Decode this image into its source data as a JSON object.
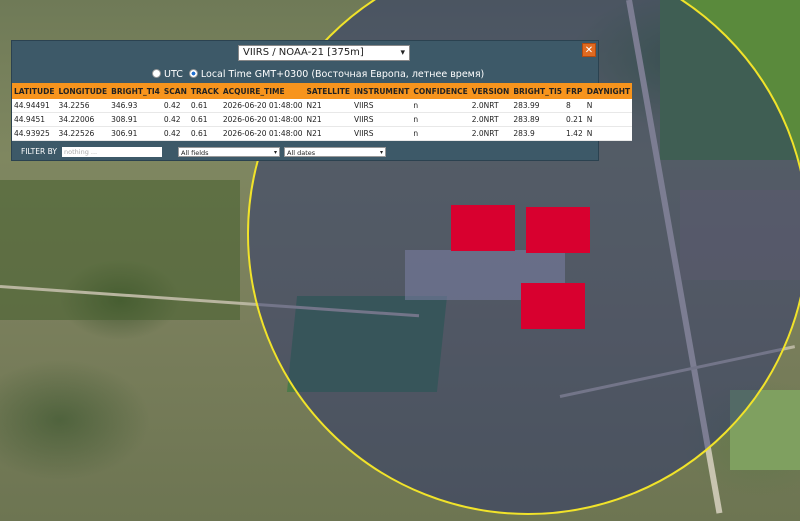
{
  "panel": {
    "dataset_select": "VIIRS / NOAA-21 [375m]",
    "close_label": "✕",
    "tz_utc": "UTC",
    "tz_local": "Local Time GMT+0300 (Восточная Европа, летнее время)",
    "table": {
      "headers": [
        "LATITUDE",
        "LONGITUDE",
        "BRIGHT_TI4",
        "SCAN",
        "TRACK",
        "ACQUIRE_TIME",
        "SATELLITE",
        "INSTRUMENT",
        "CONFIDENCE",
        "VERSION",
        "BRIGHT_TI5",
        "FRP",
        "DAYNIGHT"
      ],
      "rows": [
        [
          "44.94491",
          "34.2256",
          "346.93",
          "0.42",
          "0.61",
          "2026-06-20 01:48:00",
          "N21",
          "VIIRS",
          "n",
          "2.0NRT",
          "283.99",
          "8",
          "N"
        ],
        [
          "44.9451",
          "34.22006",
          "308.91",
          "0.42",
          "0.61",
          "2026-06-20 01:48:00",
          "N21",
          "VIIRS",
          "n",
          "2.0NRT",
          "283.89",
          "0.21",
          "N"
        ],
        [
          "44.93925",
          "34.22526",
          "306.91",
          "0.42",
          "0.61",
          "2026-06-20 01:48:00",
          "N21",
          "VIIRS",
          "n",
          "2.0NRT",
          "283.9",
          "1.42",
          "N"
        ]
      ]
    },
    "filter": {
      "label": "FILTER BY",
      "placeholder": "nothing ...",
      "fields": "All fields",
      "dates": "All dates"
    }
  },
  "colors": {
    "header": "#f7941d",
    "panel": "#3d5968",
    "fire": "#d8002f",
    "ring": "#f1e32a"
  }
}
